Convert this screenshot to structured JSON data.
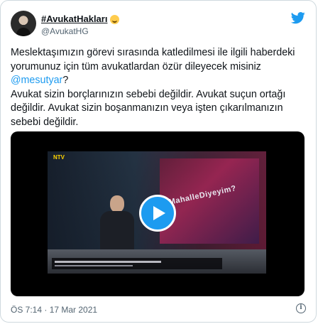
{
  "author": {
    "display_name": "#AvukatHakları",
    "handle": "@AvukatHG"
  },
  "tweet": {
    "line1": "Meslektaşımızın görevi sırasında katledilmesi ile ilgili haberdeki yorumunuz için tüm avukatlardan özür dileyecek misiniz ",
    "mention": "@mesutyar",
    "line1_end": "?",
    "line2": "Avukat sizin borçlarınızın sebebi değildir. Avukat suçun ortağı değildir. Avukat sizin boşanmanızın veya işten çıkarılmanızın sebebi değildir."
  },
  "video": {
    "channel": "NTV",
    "screen_text": "MahalleDiyeyim?"
  },
  "meta": {
    "timestamp": "ÖS 7:14 · 17 Mar 2021"
  },
  "colors": {
    "accent": "#1d9bf0",
    "text": "#0f1419",
    "muted": "#536471"
  },
  "icons": {
    "logo": "twitter-bird-icon",
    "play": "play-icon",
    "info": "info-icon",
    "emoji": "smiling-face-emoji-icon"
  }
}
